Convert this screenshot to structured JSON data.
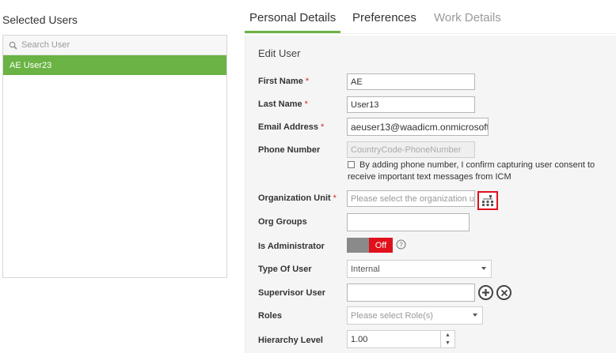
{
  "left": {
    "title": "Selected Users",
    "search_placeholder": "Search User",
    "users": [
      "AE User23"
    ]
  },
  "tabs": {
    "personal": "Personal Details",
    "preferences": "Preferences",
    "work": "Work Details"
  },
  "form": {
    "title": "Edit User",
    "required_mark": "*",
    "first_name": {
      "label": "First Name",
      "value": "AE"
    },
    "last_name": {
      "label": "Last Name",
      "value": "User13"
    },
    "email": {
      "label": "Email Address",
      "value": "aeuser13@waadicm.onmicrosoft"
    },
    "phone": {
      "label": "Phone Number",
      "placeholder": "CountryCode-PhoneNumber"
    },
    "consent_text": "By adding phone number, I confirm capturing user consent to receive important text messages from ICM",
    "org_unit": {
      "label": "Organization Unit",
      "placeholder": "Please select the organization ur"
    },
    "org_groups": {
      "label": "Org Groups",
      "value": ""
    },
    "is_admin": {
      "label": "Is Administrator",
      "toggle_text": "Off",
      "state": "off"
    },
    "type_of_user": {
      "label": "Type Of User",
      "value": "Internal"
    },
    "supervisor": {
      "label": "Supervisor User",
      "value": ""
    },
    "roles": {
      "label": "Roles",
      "placeholder": "Please select Role(s)"
    },
    "hierarchy": {
      "label": "Hierarchy Level",
      "value": "1.00"
    }
  },
  "colors": {
    "accent": "#6ab344",
    "highlight": "#e0101c"
  },
  "icons": [
    "search-icon",
    "org-tree-icon",
    "help-icon",
    "add-icon",
    "clear-icon",
    "dropdown-arrow-icon",
    "spin-up-icon",
    "spin-down-icon"
  ]
}
